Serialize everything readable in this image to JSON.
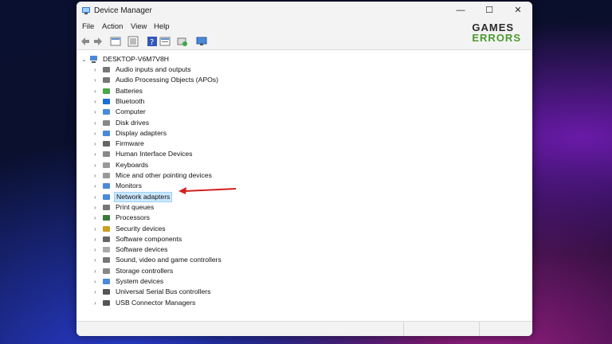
{
  "window": {
    "title": "Device Manager",
    "controls": {
      "minimize": "—",
      "maximize": "☐",
      "close": "✕"
    }
  },
  "menu": [
    "File",
    "Action",
    "View",
    "Help"
  ],
  "toolbar_icons": [
    "back-arrow-icon",
    "forward-arrow-icon",
    "properties-icon",
    "view-icon",
    "help-icon",
    "view-list-icon",
    "update-driver-icon",
    "scan-hardware-icon"
  ],
  "logo": {
    "line1": "GAMES",
    "line2": "ERRORS"
  },
  "tree": {
    "root": "DESKTOP-V6M7V8H",
    "items": [
      {
        "label": "Audio inputs and outputs",
        "icon": "speaker-icon"
      },
      {
        "label": "Audio Processing Objects (APOs)",
        "icon": "speaker-icon"
      },
      {
        "label": "Batteries",
        "icon": "battery-icon"
      },
      {
        "label": "Bluetooth",
        "icon": "bluetooth-icon"
      },
      {
        "label": "Computer",
        "icon": "computer-icon"
      },
      {
        "label": "Disk drives",
        "icon": "disk-icon"
      },
      {
        "label": "Display adapters",
        "icon": "display-icon"
      },
      {
        "label": "Firmware",
        "icon": "chip-icon"
      },
      {
        "label": "Human Interface Devices",
        "icon": "hid-icon"
      },
      {
        "label": "Keyboards",
        "icon": "keyboard-icon"
      },
      {
        "label": "Mice and other pointing devices",
        "icon": "mouse-icon"
      },
      {
        "label": "Monitors",
        "icon": "monitor-icon"
      },
      {
        "label": "Network adapters",
        "icon": "network-icon",
        "selected": true
      },
      {
        "label": "Print queues",
        "icon": "printer-icon"
      },
      {
        "label": "Processors",
        "icon": "processor-icon"
      },
      {
        "label": "Security devices",
        "icon": "key-icon"
      },
      {
        "label": "Software components",
        "icon": "puzzle-icon"
      },
      {
        "label": "Software devices",
        "icon": "software-icon"
      },
      {
        "label": "Sound, video and game controllers",
        "icon": "speaker-icon"
      },
      {
        "label": "Storage controllers",
        "icon": "storage-icon"
      },
      {
        "label": "System devices",
        "icon": "system-icon"
      },
      {
        "label": "Universal Serial Bus controllers",
        "icon": "usb-icon"
      },
      {
        "label": "USB Connector Managers",
        "icon": "usb-icon"
      }
    ]
  },
  "colors": {
    "selection": "#cce8ff",
    "arrow": "#d42020",
    "logo_green": "#4a9a2f"
  }
}
